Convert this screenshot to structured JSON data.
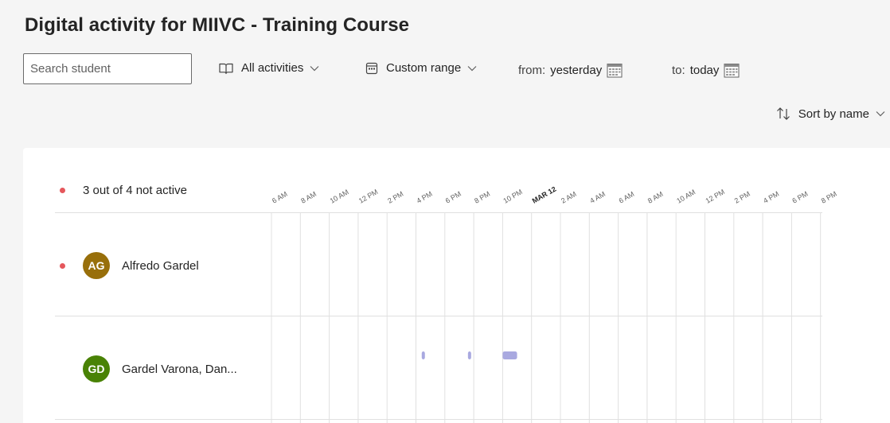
{
  "page": {
    "title": "Digital activity for MIIVC - Training Course"
  },
  "toolbar": {
    "search_placeholder": "Search student",
    "activities_label": "All activities",
    "range_label": "Custom range",
    "from_label": "from:",
    "from_value": "yesterday",
    "to_label": "to:",
    "to_value": "today",
    "sort_label": "Sort by name"
  },
  "summary": {
    "text": "3 out of 4 not active",
    "status_color": "#e5575c"
  },
  "timeline": {
    "ticks": [
      "6 AM",
      "8 AM",
      "10 AM",
      "12 PM",
      "2 PM",
      "4 PM",
      "6 PM",
      "8 PM",
      "10 PM",
      "MAR 12",
      "2 AM",
      "4 AM",
      "6 AM",
      "8 AM",
      "10 AM",
      "12 PM",
      "2 PM",
      "4 PM",
      "6 PM",
      "8 PM"
    ],
    "bold_tick": "MAR 12",
    "activity_color": "#a9a9e0"
  },
  "students": [
    {
      "initials": "AG",
      "name": "Alfredo Gardel",
      "avatar_color": "#986f0b",
      "inactive": true,
      "activity": []
    },
    {
      "initials": "GD",
      "name": "Gardel Varona, Dan...",
      "avatar_color": "#498205",
      "inactive": false,
      "activity": [
        {
          "start": 16.4,
          "end": 16.6
        },
        {
          "start": 19.6,
          "end": 19.8
        },
        {
          "start": 22.0,
          "end": 23.0
        }
      ]
    }
  ]
}
